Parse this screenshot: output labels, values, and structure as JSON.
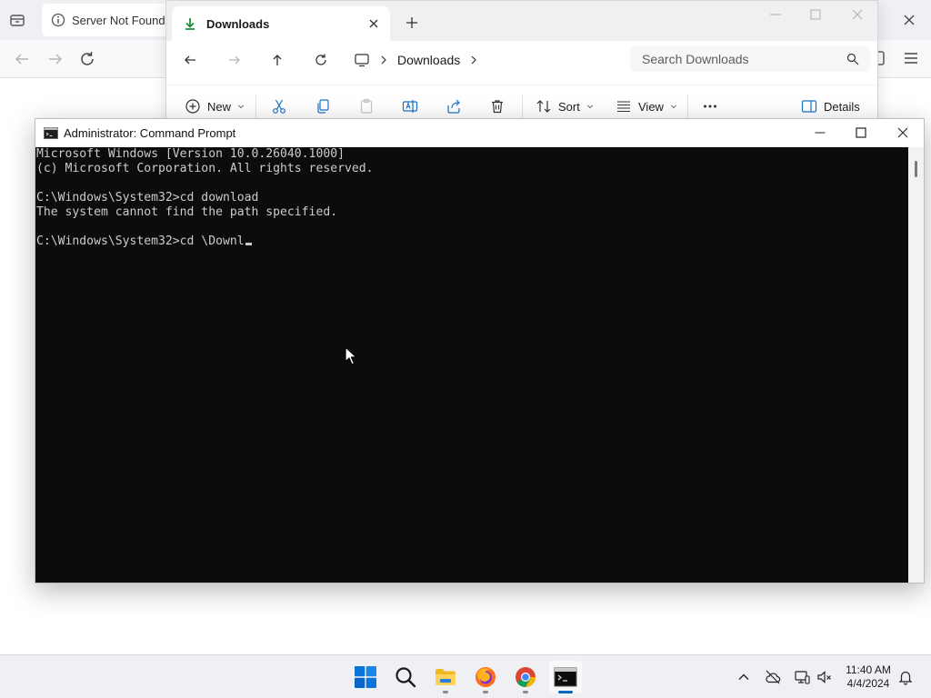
{
  "browser": {
    "tab_title": "Server Not Found",
    "icons": [
      "tab-list-icon",
      "info-icon",
      "back-icon",
      "forward-icon",
      "reload-icon",
      "menu-icon",
      "close-icon"
    ]
  },
  "explorer": {
    "tab_title": "Downloads",
    "breadcrumb": [
      "Downloads"
    ],
    "search_placeholder": "Search Downloads",
    "commands": {
      "new_label": "New",
      "sort_label": "Sort",
      "view_label": "View",
      "details_label": "Details"
    }
  },
  "cmd": {
    "title": "Administrator: Command Prompt",
    "lines": [
      "Microsoft Windows [Version 10.0.26040.1000]",
      "(c) Microsoft Corporation. All rights reserved.",
      "",
      "C:\\Windows\\System32>cd download",
      "The system cannot find the path specified.",
      "",
      "C:\\Windows\\System32>cd \\Downl"
    ]
  },
  "taskbar": {
    "apps": [
      "start",
      "search",
      "file-explorer",
      "firefox",
      "chrome",
      "command-prompt"
    ],
    "active_app": "command-prompt",
    "clock": {
      "time": "11:40 AM",
      "date": "4/4/2024"
    }
  },
  "colors": {
    "console_bg": "#0c0c0c",
    "console_fg": "#cccccc",
    "accent": "#0067c0",
    "download_green": "#1e8e3e"
  }
}
